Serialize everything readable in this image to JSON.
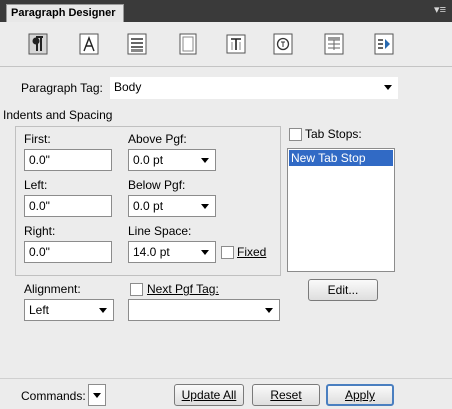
{
  "window": {
    "title": "Paragraph Designer",
    "menu_glyph": "▾≡"
  },
  "toolbar": {
    "buttons": [
      {
        "name": "pilcrow-icon"
      },
      {
        "name": "font-a-icon"
      },
      {
        "name": "paragraph-lines-icon"
      },
      {
        "name": "page-icon"
      },
      {
        "name": "text-frame-icon"
      },
      {
        "name": "hyphen-icon"
      },
      {
        "name": "table-cell-icon"
      },
      {
        "name": "advanced-icon"
      }
    ]
  },
  "paragraph_tag": {
    "label": "Paragraph Tag:",
    "value": "Body"
  },
  "indents": {
    "section_label": "Indents and Spacing",
    "first_label": "First:",
    "first_value": "0.0\"",
    "left_label": "Left:",
    "left_value": "0.0\"",
    "right_label": "Right:",
    "right_value": "0.0\"",
    "above_label": "Above Pgf:",
    "above_value": "0.0 pt",
    "below_label": "Below Pgf:",
    "below_value": "0.0 pt",
    "linespace_label": "Line Space:",
    "linespace_value": "14.0 pt",
    "fixed_label": "Fixed"
  },
  "tab_stops": {
    "label": "Tab Stops:",
    "items": [
      "New Tab Stop"
    ],
    "edit_label": "Edit..."
  },
  "alignment": {
    "label": "Alignment:",
    "value": "Left"
  },
  "next_pgf": {
    "label": "Next Pgf Tag:",
    "value": ""
  },
  "footer": {
    "commands_label": "Commands:",
    "update_all_label": "Update All",
    "reset_label": "Reset",
    "apply_label": "Apply"
  },
  "colors": {
    "title_bg": "#3a3a3a",
    "panel_bg": "#ececec",
    "selection": "#316ac5",
    "default_button_border": "#4a7fc0"
  }
}
